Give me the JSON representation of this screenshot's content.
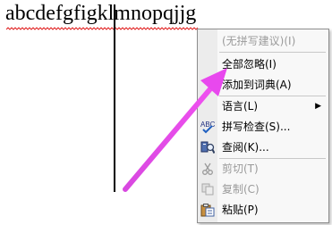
{
  "document": {
    "text_before_cursor": "abcdefgfigkl",
    "text_after_cursor": "mnopqjjg"
  },
  "context_menu": {
    "items": [
      {
        "label": "(无拼写建议)(I)",
        "enabled": false,
        "icon": ""
      },
      {
        "label": "全部忽略(I)",
        "enabled": true,
        "icon": ""
      },
      {
        "label": "添加到词典(A)",
        "enabled": true,
        "icon": ""
      },
      {
        "label": "语言(L)",
        "enabled": true,
        "icon": "",
        "submenu": true
      },
      {
        "label": "拼写检查(S)...",
        "enabled": true,
        "icon": "spellcheck-icon"
      },
      {
        "label": "查阅(K)...",
        "enabled": true,
        "icon": "research-icon"
      },
      {
        "label": "剪切(T)",
        "enabled": false,
        "icon": "scissors-icon"
      },
      {
        "label": "复制(C)",
        "enabled": false,
        "icon": "copy-icon"
      },
      {
        "label": "粘贴(P)",
        "enabled": true,
        "icon": "paste-icon"
      }
    ]
  },
  "colors": {
    "annotation_arrow": "#e040e8",
    "spelling_squiggle": "#e02020",
    "disabled_text": "#9a9a9a"
  }
}
